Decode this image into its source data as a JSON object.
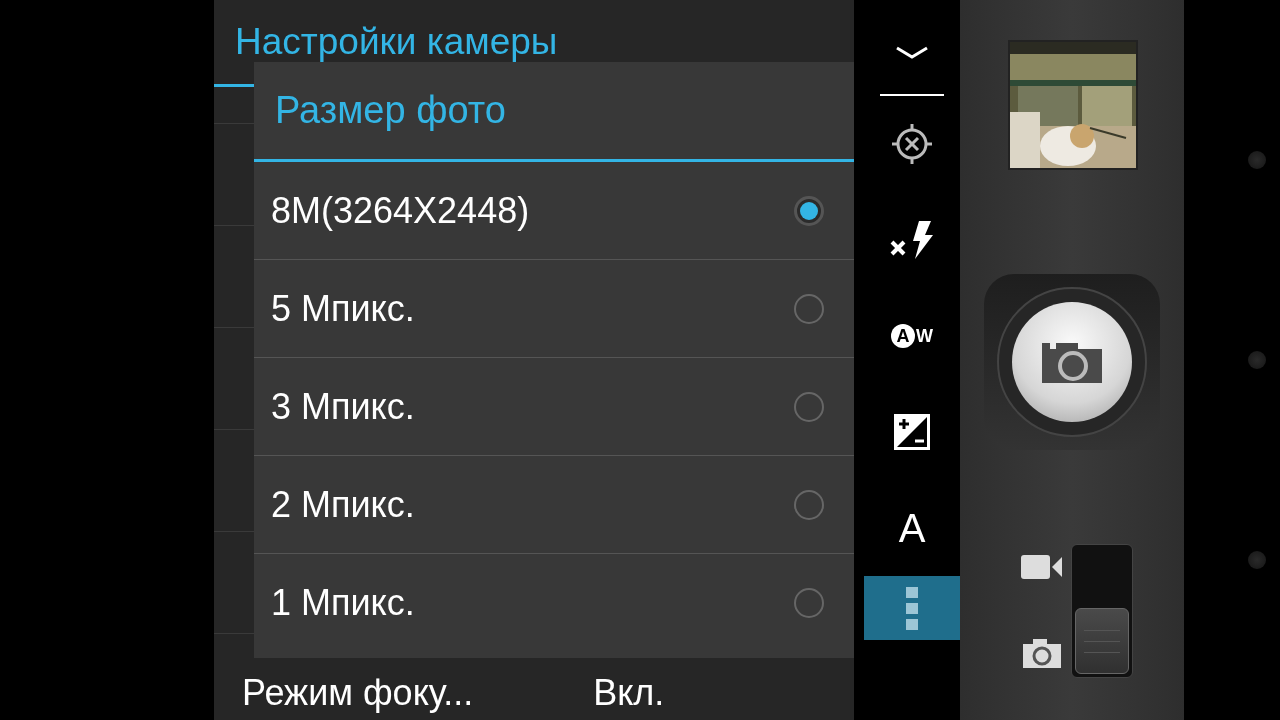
{
  "settings": {
    "title": "Настройки камеры",
    "last_row": {
      "label": "Режим фоку...",
      "value": "Вкл."
    }
  },
  "dialog": {
    "title": "Размер фото",
    "options": [
      {
        "label": "8M(3264X2448)",
        "selected": true
      },
      {
        "label": "5 Мпикс.",
        "selected": false
      },
      {
        "label": "3 Мпикс.",
        "selected": false
      },
      {
        "label": "2 Мпикс.",
        "selected": false
      },
      {
        "label": "1 Мпикс.",
        "selected": false
      }
    ]
  },
  "toolbar": {
    "items": [
      {
        "kind": "focus"
      },
      {
        "kind": "flash-off"
      },
      {
        "kind": "white-balance",
        "badge": "A",
        "suffix": "W"
      },
      {
        "kind": "exposure"
      },
      {
        "kind": "text",
        "text": "A"
      }
    ],
    "menu_selected": true
  },
  "mode_switch": {
    "photo": true
  }
}
